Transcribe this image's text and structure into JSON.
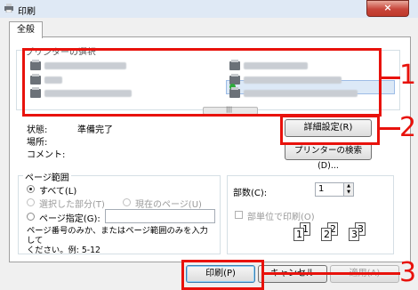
{
  "window": {
    "title": "印刷",
    "close_glyph": "×"
  },
  "tabs": [
    {
      "label": "全般"
    }
  ],
  "printer_select": {
    "group_label": "プリンターの選択",
    "printers": [
      "",
      "",
      "",
      "",
      "",
      ""
    ]
  },
  "status": {
    "state_label": "状態:",
    "state_value": "準備完了",
    "location_label": "場所:",
    "comment_label": "コメント:"
  },
  "buttons": {
    "preferences": "詳細設定(R)",
    "find_printer": "プリンターの検索(D)...",
    "print": "印刷(P)",
    "cancel": "キャンセル",
    "apply": "適用(A)"
  },
  "page_range": {
    "group_label": "ページ範囲",
    "all": "すべて(L)",
    "selection": "選択した部分(T)",
    "current_page": "現在のページ(U)",
    "pages": "ページ指定(G):",
    "pages_value": "",
    "hint": "ページ番号のみか、またはページ範囲のみを入力して\nください。例: 5-12",
    "selected": "all"
  },
  "copies": {
    "label": "部数(C):",
    "value": "1",
    "collate_label": "部単位で印刷(O)",
    "collate_checked": false,
    "collate_icons": [
      "1",
      "1",
      "2",
      "2",
      "3",
      "3"
    ]
  },
  "callouts": [
    "1",
    "2",
    "3"
  ],
  "colors": {
    "callout": "#e8120c",
    "selection": "#dce9f7"
  }
}
